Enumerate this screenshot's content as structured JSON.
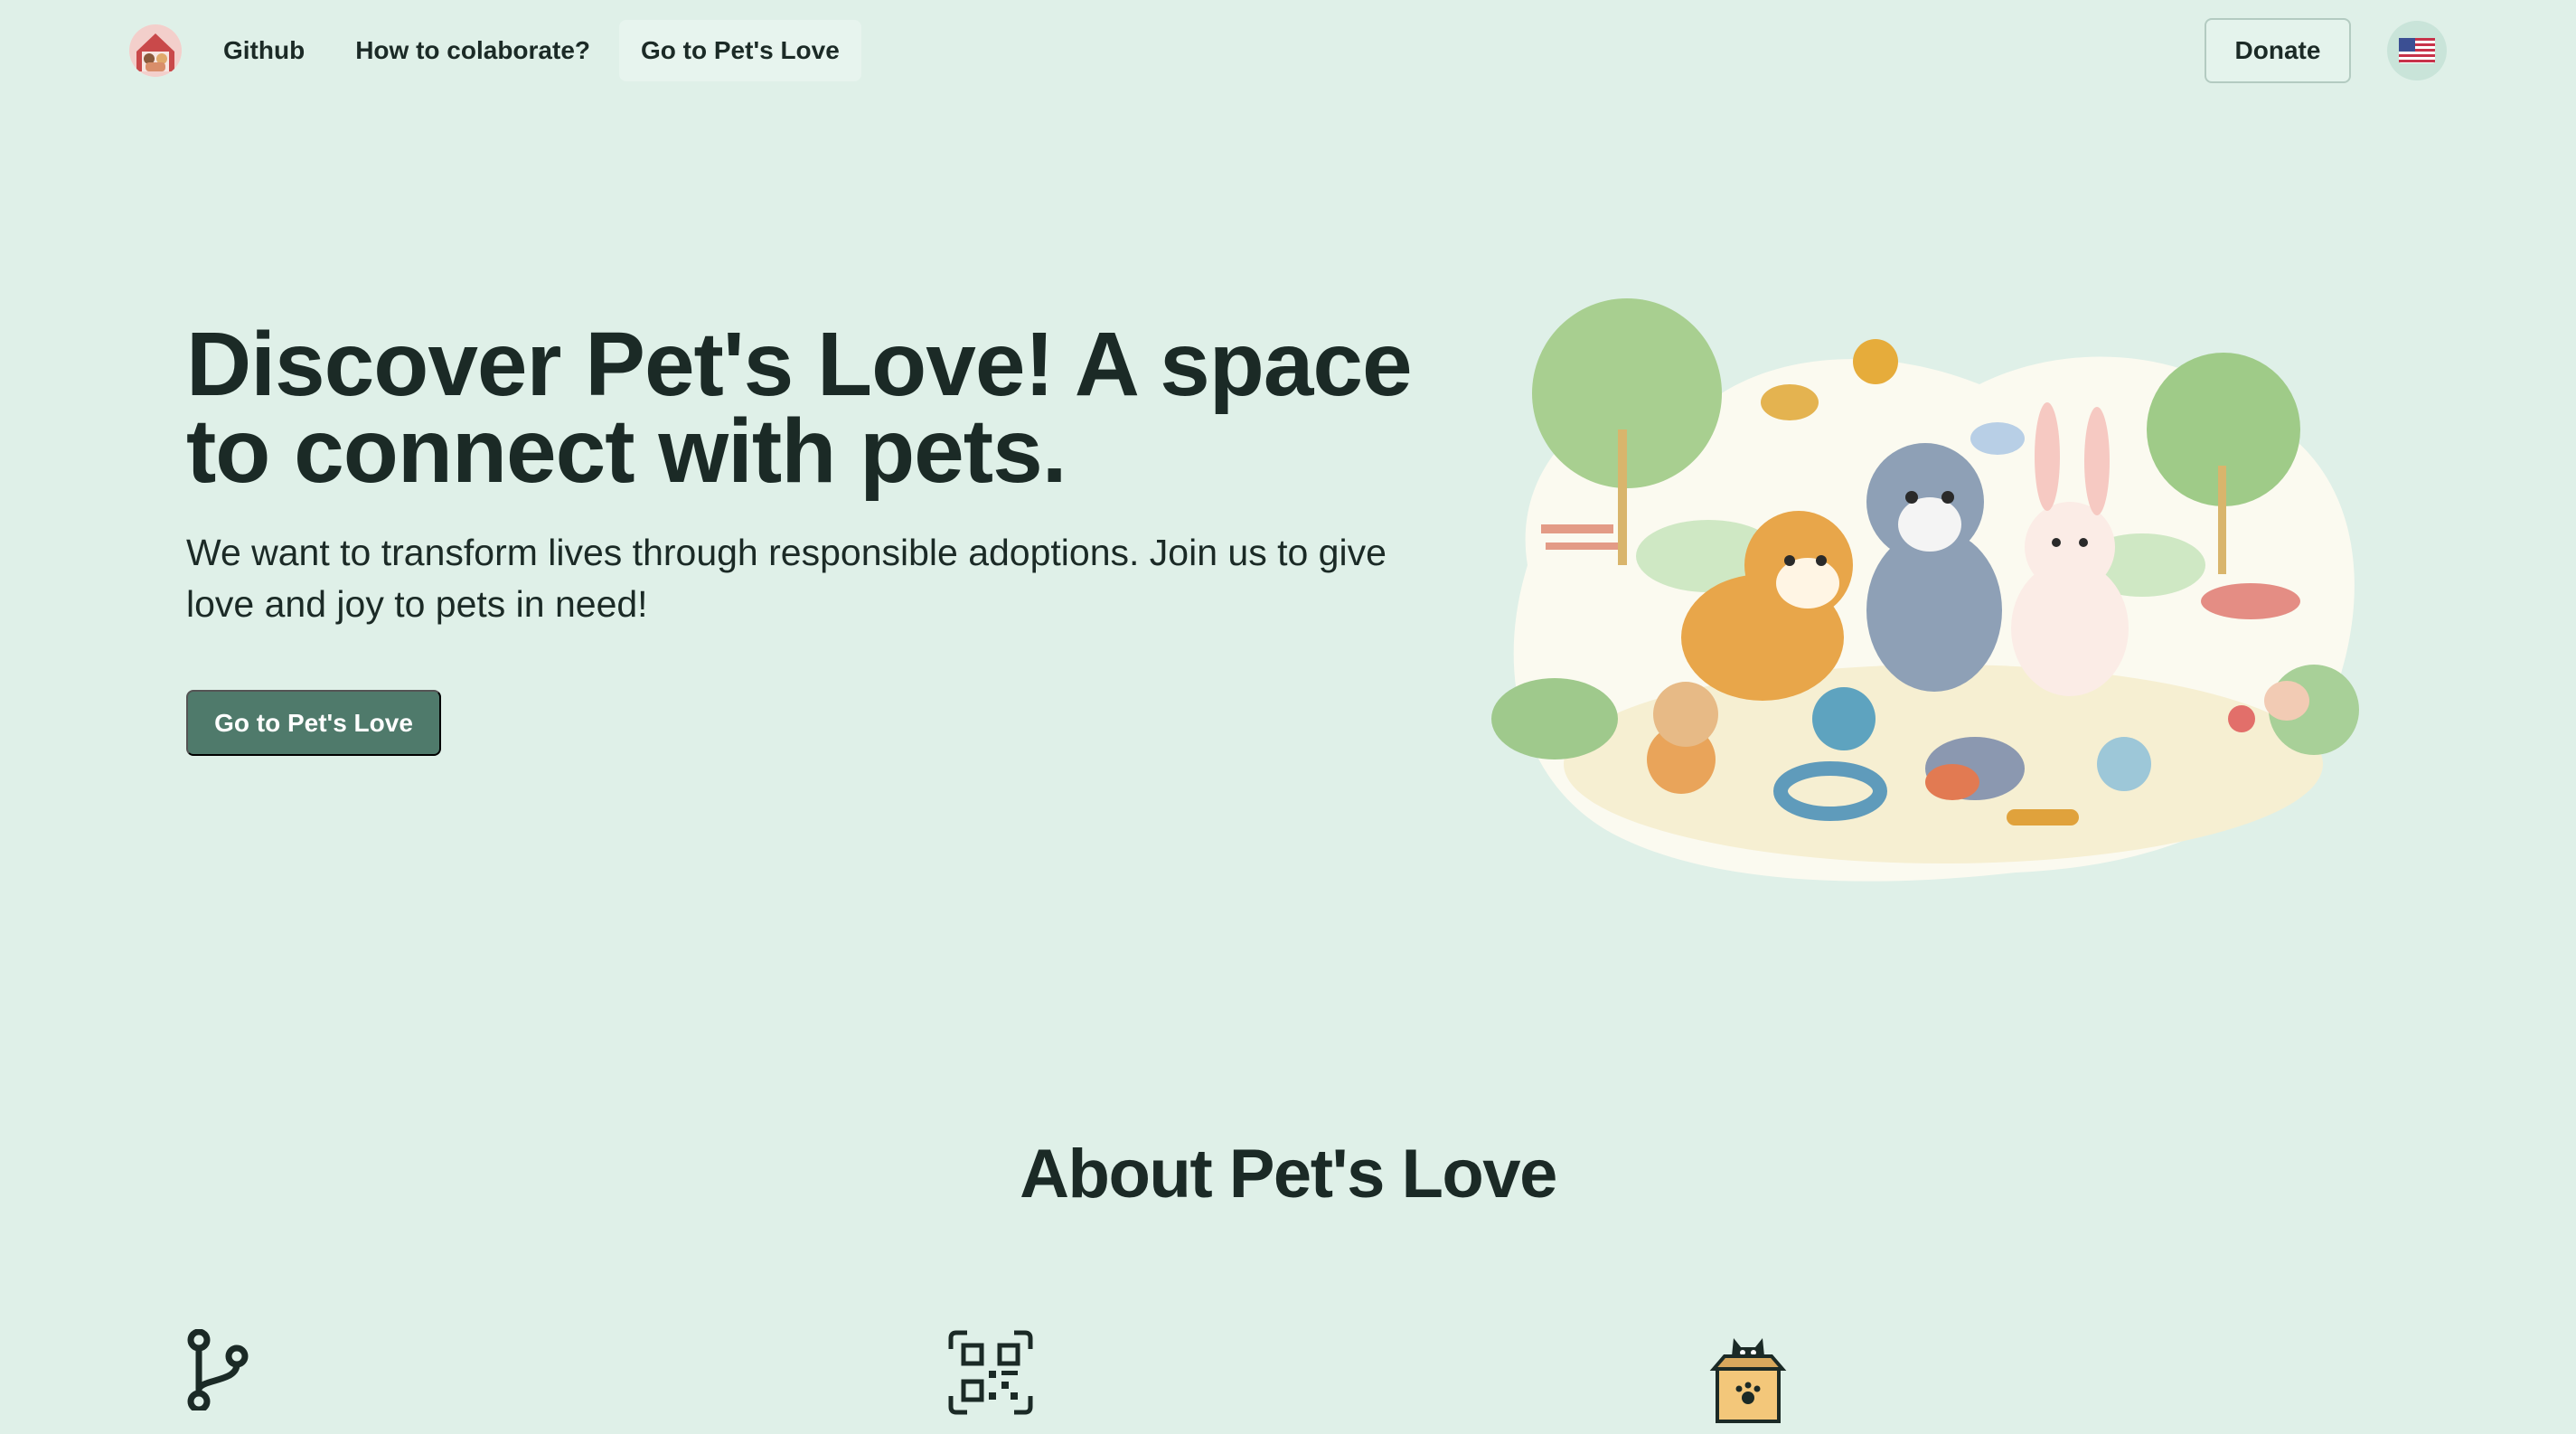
{
  "nav": {
    "logo_icon": "pets-love-logo",
    "links": [
      {
        "label": "Github"
      },
      {
        "label": "How to colaborate?"
      },
      {
        "label": "Go to Pet's Love"
      }
    ],
    "donate_label": "Donate",
    "language_icon": "us-flag-icon"
  },
  "hero": {
    "title": "Discover Pet's Love! A space to connect with pets.",
    "subtitle": "We want to transform lives through responsible adoptions. Join us to give love and joy to pets in need!",
    "cta_label": "Go to Pet's Love",
    "illustration": "pets-playing-in-park-illustration"
  },
  "about": {
    "title": "About Pet's Love",
    "feature_icons": [
      "git-branch-icon",
      "qr-code-icon",
      "cat-in-box-icon"
    ]
  },
  "colors": {
    "background": "#dff0e8",
    "primary_button": "#4f7a6b",
    "text": "#1b2a26"
  }
}
